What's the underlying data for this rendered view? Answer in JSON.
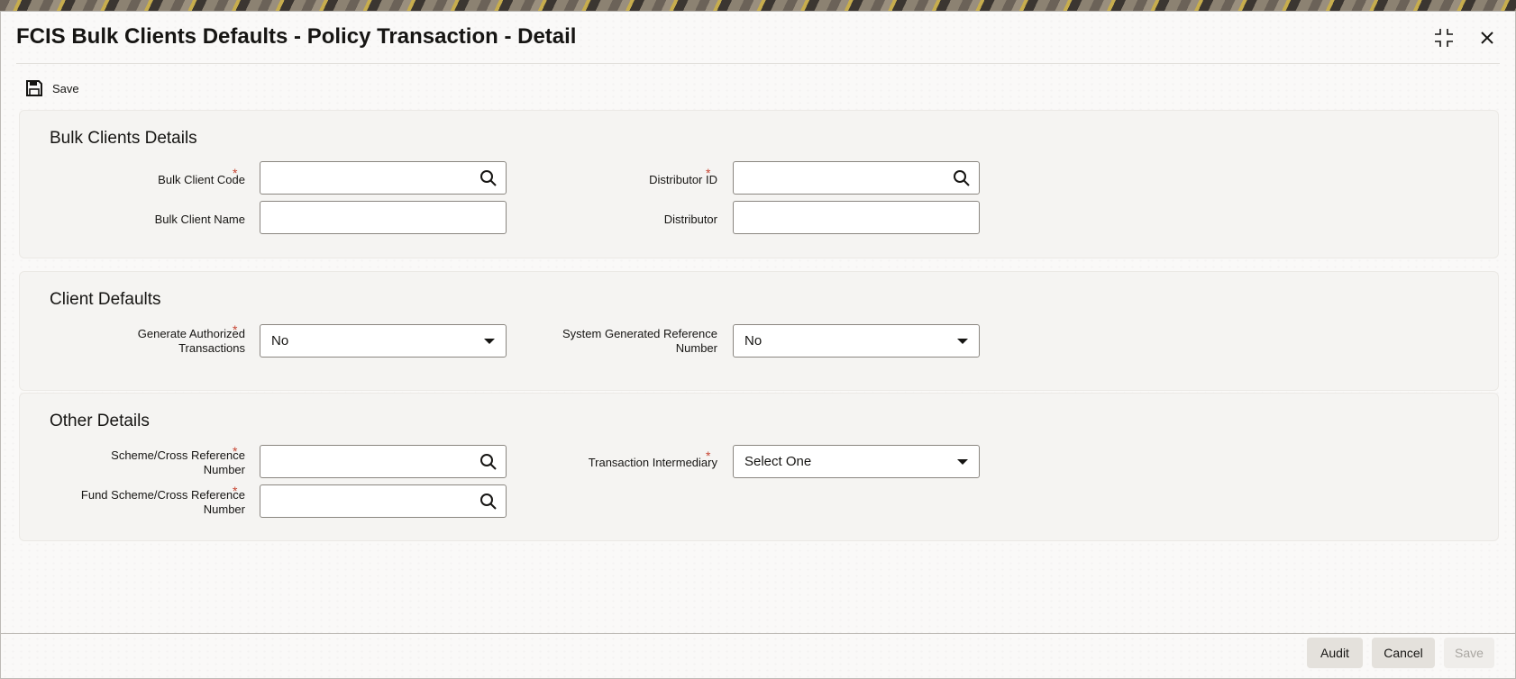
{
  "window": {
    "title": "FCIS Bulk Clients Defaults - Policy Transaction - Detail"
  },
  "toolbar": {
    "save_label": "Save"
  },
  "sections": {
    "bulk_clients": {
      "title": "Bulk Clients Details",
      "bulk_client_code_label": "Bulk Client Code",
      "bulk_client_code_value": "",
      "bulk_client_name_label": "Bulk Client Name",
      "bulk_client_name_value": "",
      "distributor_id_label": "Distributor ID",
      "distributor_id_value": "",
      "distributor_label": "Distributor",
      "distributor_value": ""
    },
    "client_defaults": {
      "title": "Client Defaults",
      "generate_auth_label_1": "Generate Authorized",
      "generate_auth_label_2": "Transactions",
      "generate_auth_value": "No",
      "sys_ref_label_1": "System Generated Reference",
      "sys_ref_label_2": "Number",
      "sys_ref_value": "No"
    },
    "other_details": {
      "title": "Other Details",
      "scheme_label_1": "Scheme/Cross Reference",
      "scheme_label_2": "Number",
      "scheme_value": "",
      "fund_scheme_label_1": "Fund Scheme/Cross Reference",
      "fund_scheme_label_2": "Number",
      "fund_scheme_value": "",
      "intermediary_label": "Transaction Intermediary",
      "intermediary_value": "Select One"
    }
  },
  "required_marker": "*",
  "footer": {
    "audit": "Audit",
    "cancel": "Cancel",
    "save": "Save"
  },
  "icons": {
    "save": "floppy-disk-icon",
    "search": "magnifier-icon",
    "maximize": "maximize-icon",
    "close": "close-icon",
    "dropdown": "caret-down-icon"
  }
}
